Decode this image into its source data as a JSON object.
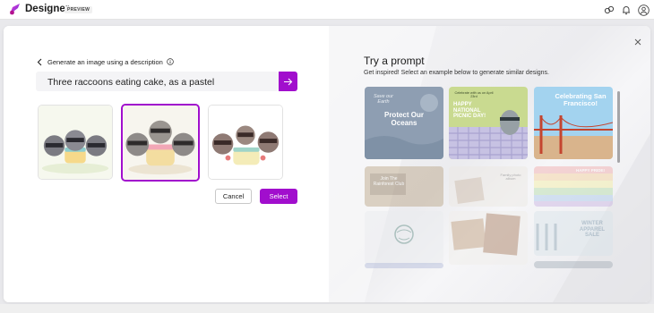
{
  "topbar": {
    "app_title": "Designer",
    "preview_badge": "PREVIEW",
    "icons": [
      "logo-icon",
      "magic-icon",
      "bell-icon",
      "profile-icon"
    ]
  },
  "generator": {
    "back_label": "Generate an image using a description",
    "prompt_value": "Three raccoons eating cake, as a pastel",
    "results": [
      {
        "name": "raccoons-cake-option-1",
        "selected": false
      },
      {
        "name": "raccoons-cake-option-2",
        "selected": true
      },
      {
        "name": "raccoons-cake-option-3",
        "selected": false
      }
    ],
    "cancel_label": "Cancel",
    "select_label": "Select"
  },
  "try_prompt": {
    "title": "Try a prompt",
    "subtitle": "Get inspired! Select an example below to generate similar designs.",
    "cards": [
      {
        "text": "Protect Our Oceans",
        "script_text": "Save our Earth"
      },
      {
        "text": "HAPPY NATIONAL PICNIC DAY!",
        "small_text": "Celebrate with us on April 23rd"
      },
      {
        "text": "Celebrating San Francisco!"
      },
      {
        "text": "Join The Rainforest Club"
      },
      {
        "text": "Family photo album"
      },
      {
        "text": "HAPPY PRIDE!"
      },
      {
        "text": ""
      },
      {
        "text": ""
      },
      {
        "text": "WINTER APPAREL SALE"
      }
    ]
  },
  "colors": {
    "accent": "#a10ecd",
    "ocean_card": "#8d9db0",
    "picnic_card": "#c7d98e",
    "sf_card": "#9fd0ec"
  }
}
